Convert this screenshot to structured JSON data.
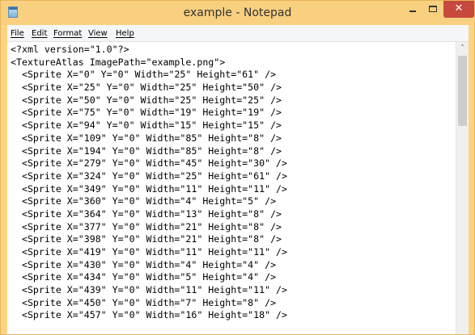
{
  "window": {
    "title": "example - Notepad",
    "close_glyph": "✕"
  },
  "menu": {
    "file": {
      "key": "F",
      "rest": "ile"
    },
    "edit": {
      "key": "E",
      "rest": "dit"
    },
    "format": {
      "key": "F",
      "rest": "ormat"
    },
    "view": {
      "key": "V",
      "rest": "iew"
    },
    "help": {
      "key": "H",
      "rest": "elp"
    }
  },
  "scrollbar": {
    "up_glyph": "˄",
    "thumb_position_fraction": 0.0
  },
  "document": {
    "lines": [
      "<?xml version=\"1.0\"?>",
      "<TextureAtlas ImagePath=\"example.png\">",
      "  <Sprite X=\"0\" Y=\"0\" Width=\"25\" Height=\"61\" />",
      "  <Sprite X=\"25\" Y=\"0\" Width=\"25\" Height=\"50\" />",
      "  <Sprite X=\"50\" Y=\"0\" Width=\"25\" Height=\"25\" />",
      "  <Sprite X=\"75\" Y=\"0\" Width=\"19\" Height=\"19\" />",
      "  <Sprite X=\"94\" Y=\"0\" Width=\"15\" Height=\"15\" />",
      "  <Sprite X=\"109\" Y=\"0\" Width=\"85\" Height=\"8\" />",
      "  <Sprite X=\"194\" Y=\"0\" Width=\"85\" Height=\"8\" />",
      "  <Sprite X=\"279\" Y=\"0\" Width=\"45\" Height=\"30\" />",
      "  <Sprite X=\"324\" Y=\"0\" Width=\"25\" Height=\"61\" />",
      "  <Sprite X=\"349\" Y=\"0\" Width=\"11\" Height=\"11\" />",
      "  <Sprite X=\"360\" Y=\"0\" Width=\"4\" Height=\"5\" />",
      "  <Sprite X=\"364\" Y=\"0\" Width=\"13\" Height=\"8\" />",
      "  <Sprite X=\"377\" Y=\"0\" Width=\"21\" Height=\"8\" />",
      "  <Sprite X=\"398\" Y=\"0\" Width=\"21\" Height=\"8\" />",
      "  <Sprite X=\"419\" Y=\"0\" Width=\"11\" Height=\"11\" />",
      "  <Sprite X=\"430\" Y=\"0\" Width=\"4\" Height=\"4\" />",
      "  <Sprite X=\"434\" Y=\"0\" Width=\"5\" Height=\"4\" />",
      "  <Sprite X=\"439\" Y=\"0\" Width=\"11\" Height=\"11\" />",
      "  <Sprite X=\"450\" Y=\"0\" Width=\"7\" Height=\"8\" />",
      "  <Sprite X=\"457\" Y=\"0\" Width=\"16\" Height=\"18\" />"
    ]
  }
}
